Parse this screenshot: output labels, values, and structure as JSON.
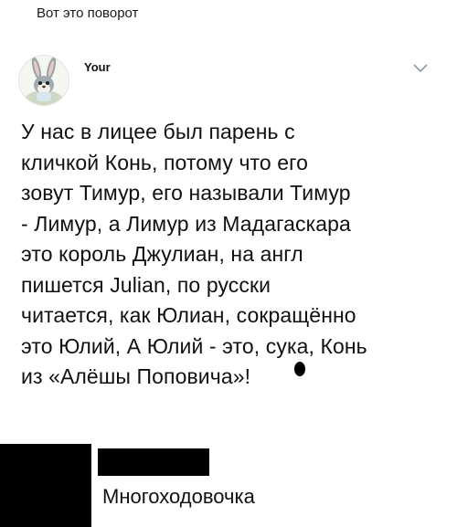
{
  "header": {
    "caption": "Вот это поворот"
  },
  "tweet": {
    "author": {
      "name": "Your",
      "avatar_icon": "bugs-bunny-avatar-icon"
    },
    "menu_icon": "chevron-down-icon",
    "text": "У нас в лицее был парень с\nкличкой Конь, потому что его\nзовут Тимур, его называли Тимур\n- Лимур, а Лимур из Мадагаскара\nэто король Джулиан, на англ\nпишется Julian, по русски\nчитается, как Юлиан, сокращённо\nэто Юлий, А Юлий - это, сука, Конь\nиз «Алёшы Поповича»!"
  },
  "reply": {
    "avatar": "redacted",
    "name": "redacted",
    "text": "Многоходовочка"
  },
  "colors": {
    "text": "#111111",
    "redaction": "#000000",
    "background": "#ffffff"
  }
}
